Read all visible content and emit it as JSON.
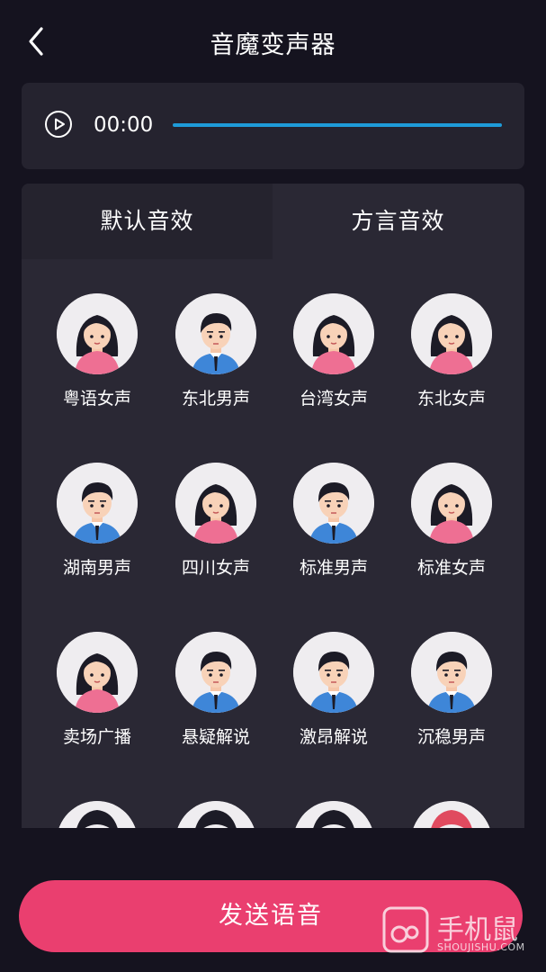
{
  "header": {
    "title": "音魔变声器",
    "back_icon": "chevron-left-icon"
  },
  "player": {
    "time": "00:00",
    "progress": 1.0,
    "play_icon": "play-circle-icon",
    "accent": "#1e9bd9"
  },
  "tabs": [
    {
      "label": "默认音效",
      "selected": false
    },
    {
      "label": "方言音效",
      "selected": true
    }
  ],
  "voices": [
    {
      "label": "粤语女声",
      "avatar": "female"
    },
    {
      "label": "东北男声",
      "avatar": "male"
    },
    {
      "label": "台湾女声",
      "avatar": "female"
    },
    {
      "label": "东北女声",
      "avatar": "female"
    },
    {
      "label": "湖南男声",
      "avatar": "male"
    },
    {
      "label": "四川女声",
      "avatar": "female"
    },
    {
      "label": "标准男声",
      "avatar": "male"
    },
    {
      "label": "标准女声",
      "avatar": "female"
    },
    {
      "label": "卖场广播",
      "avatar": "female"
    },
    {
      "label": "悬疑解说",
      "avatar": "male"
    },
    {
      "label": "激昂解说",
      "avatar": "male"
    },
    {
      "label": "沉稳男声",
      "avatar": "male"
    },
    {
      "label": "",
      "avatar": "partial"
    },
    {
      "label": "",
      "avatar": "partial"
    },
    {
      "label": "",
      "avatar": "partial"
    },
    {
      "label": "",
      "avatar": "partial"
    }
  ],
  "send_button": {
    "label": "发送语音",
    "color": "#ea3f6f"
  },
  "watermark": {
    "text": "手机鼠",
    "subtext": "SHOUJISHU.COM"
  }
}
